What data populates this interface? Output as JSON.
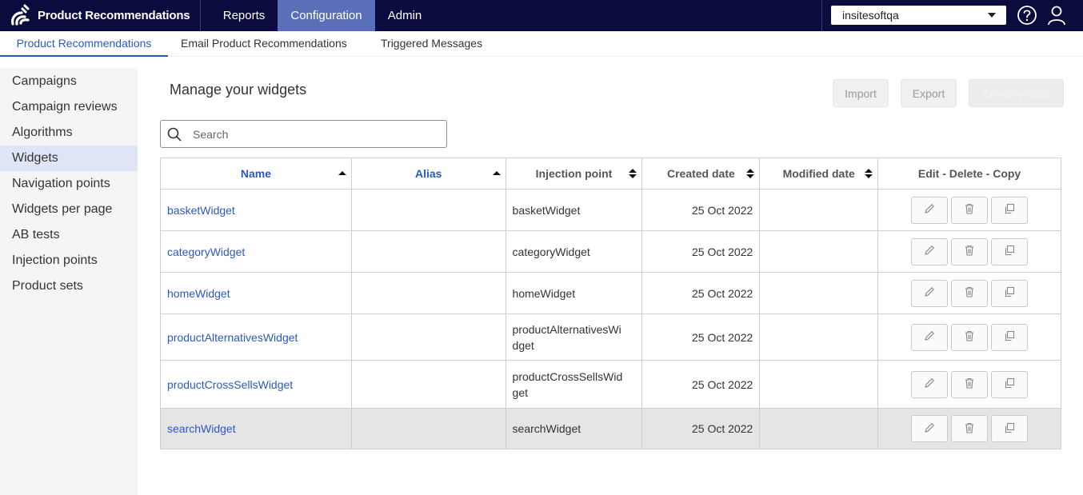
{
  "app": {
    "title": "Product Recommendations"
  },
  "topnav": [
    {
      "label": "Reports"
    },
    {
      "label": "Configuration"
    },
    {
      "label": "Admin"
    }
  ],
  "account": {
    "selected": "insitesoftqa"
  },
  "subnav": [
    {
      "label": "Product Recommendations"
    },
    {
      "label": "Email Product Recommendations"
    },
    {
      "label": "Triggered Messages"
    }
  ],
  "sidebar": {
    "items": [
      {
        "label": "Campaigns"
      },
      {
        "label": "Campaign reviews"
      },
      {
        "label": "Algorithms"
      },
      {
        "label": "Widgets"
      },
      {
        "label": "Navigation points"
      },
      {
        "label": "Widgets per page"
      },
      {
        "label": "AB tests"
      },
      {
        "label": "Injection points"
      },
      {
        "label": "Product sets"
      }
    ],
    "active": "Widgets"
  },
  "main": {
    "heading": "Manage your widgets",
    "buttons": {
      "import": "Import",
      "export": "Export",
      "create": "Create widget"
    },
    "search": {
      "placeholder": "Search",
      "value": ""
    }
  },
  "table": {
    "columns": [
      "Name",
      "Alias",
      "Injection point",
      "Created date",
      "Modified date",
      "Edit - Delete - Copy"
    ],
    "rows": [
      {
        "name": "basketWidget",
        "alias": "",
        "injection_line1": "basketWidget",
        "injection_line2": "",
        "created": "25 Oct 2022",
        "modified": ""
      },
      {
        "name": "categoryWidget",
        "alias": "",
        "injection_line1": "categoryWidget",
        "injection_line2": "",
        "created": "25 Oct 2022",
        "modified": ""
      },
      {
        "name": "homeWidget",
        "alias": "",
        "injection_line1": "homeWidget",
        "injection_line2": "",
        "created": "25 Oct 2022",
        "modified": ""
      },
      {
        "name": "productAlternativesWidget",
        "alias": "",
        "injection_line1": "productAlternativesWi",
        "injection_line2": "dget",
        "created": "25 Oct 2022",
        "modified": ""
      },
      {
        "name": "productCrossSellsWidget",
        "alias": "",
        "injection_line1": "productCrossSellsWid",
        "injection_line2": "get",
        "created": "25 Oct 2022",
        "modified": ""
      },
      {
        "name": "searchWidget",
        "alias": "",
        "injection_line1": "searchWidget",
        "injection_line2": "",
        "created": "25 Oct 2022",
        "modified": ""
      }
    ]
  },
  "colors": {
    "topbar": "#0b0c3d",
    "active_nav": "#5b6fb8",
    "link": "#2b59c3",
    "sidebar_active": "#dfe5f6"
  }
}
